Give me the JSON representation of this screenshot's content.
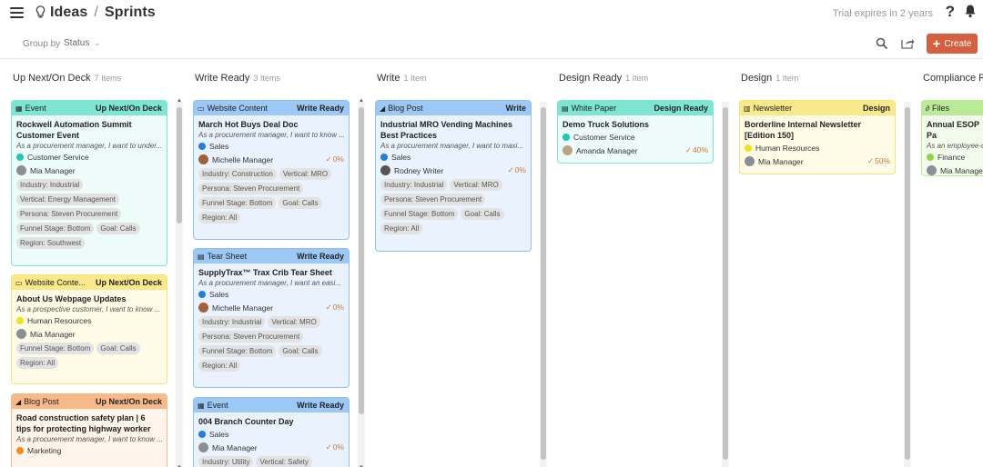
{
  "header": {
    "breadcrumb": [
      "Ideas",
      "Sprints"
    ],
    "trial": "Trial expires in 2 years"
  },
  "toolbar": {
    "group_by_label": "Group by",
    "group_by_value": "Status",
    "create_label": "Create"
  },
  "columns": [
    {
      "title": "Up Next/On Deck",
      "count": "7 Items"
    },
    {
      "title": "Write Ready",
      "count": "3 Items"
    },
    {
      "title": "Write",
      "count": "1 Item"
    },
    {
      "title": "Design Ready",
      "count": "1 Item"
    },
    {
      "title": "Design",
      "count": "1 Item"
    },
    {
      "title": "Compliance Re",
      "count": ""
    }
  ],
  "cards": [
    {
      "type": "Event",
      "status": "Up Next/On Deck",
      "title": "Rockwell Automation Summit Customer Event",
      "desc": "As a procurement manager, I want to under...",
      "dept": "Customer Service",
      "owner": "Mia Manager",
      "pct": "",
      "tags": [
        "Industry: Industrial",
        "Vertical: Energy Management",
        "Persona: Steven Procurement",
        "Funnel Stage: Bottom",
        "Goal: Calls",
        "Region: Southwest"
      ]
    },
    {
      "type": "Website Conte...",
      "status": "Up Next/On Deck",
      "title": "About Us Webpage Updates",
      "desc": "As a prospective customer, I want to know ...",
      "dept": "Human Resources",
      "owner": "Mia Manager",
      "pct": "",
      "tags": [
        "Funnel Stage: Bottom",
        "Goal: Calls",
        "Region: All"
      ]
    },
    {
      "type": "Blog Post",
      "status": "Up Next/On Deck",
      "title": "Road construction safety plan | 6 tips for protecting highway worker",
      "desc": "As a procurement manager, I want to know ...",
      "dept": "Marketing",
      "owner": "",
      "pct": "",
      "tags": []
    },
    {
      "type": "Website Content",
      "status": "Write Ready",
      "title": "March Hot Buys Deal Doc",
      "desc": "As a procurement manager, I want to know ...",
      "dept": "Sales",
      "owner": "Michelle Manager",
      "pct": "0%",
      "tags": [
        "Industry: Construction",
        "Vertical: MRO",
        "Persona: Steven Procurement",
        "Funnel Stage: Bottom",
        "Goal: Calls",
        "Region: All"
      ]
    },
    {
      "type": "Tear Sheet",
      "status": "Write Ready",
      "title": "SupplyTrax™ Trax Crib Tear Sheet",
      "desc": "As a procurement manager, I want an easi...",
      "dept": "Sales",
      "owner": "Michelle Manager",
      "pct": "0%",
      "tags": [
        "Industry: Industrial",
        "Vertical: MRO",
        "Persona: Steven Procurement",
        "Funnel Stage: Bottom",
        "Goal: Calls",
        "Region: All"
      ]
    },
    {
      "type": "Event",
      "status": "Write Ready",
      "title": "004 Branch Counter Day",
      "desc": "",
      "dept": "Sales",
      "owner": "Mia Manager",
      "pct": "0%",
      "tags": [
        "Industry: Utility",
        "Vertical: Safety"
      ]
    },
    {
      "type": "Blog Post",
      "status": "Write",
      "title": "Industrial MRO Vending Machines Best Practices",
      "desc": "As a procurement manager, I want to maxi...",
      "dept": "Sales",
      "owner": "Rodney Writer",
      "pct": "0%",
      "tags": [
        "Industry: Industrial",
        "Vertical: MRO",
        "Persona: Steven Procurement",
        "Funnel Stage: Bottom",
        "Goal: Calls",
        "Region: All"
      ]
    },
    {
      "type": "White Paper",
      "status": "Design Ready",
      "title": "Demo Truck Solutions",
      "desc": "",
      "dept": "Customer Service",
      "owner": "Amanda Manager",
      "pct": "40%",
      "tags": []
    },
    {
      "type": "Newsletter",
      "status": "Design",
      "title": "Borderline Internal Newsletter [Edition 150]",
      "desc": "",
      "dept": "Human Resources",
      "owner": "Mia Manager",
      "pct": "50%",
      "tags": []
    },
    {
      "type": "Files",
      "status": "",
      "title": "Annual ESOP Pa",
      "desc": "As an employee-o",
      "dept": "Finance",
      "owner": "Mia Manage",
      "pct": "",
      "tags": []
    }
  ],
  "colors": {
    "event_head": "#7fe5d3",
    "event_bg": "#eefcf9",
    "website_head": "#f9e98a",
    "website_bg": "#fffbe6",
    "blog_head": "#f8b98a",
    "blog_bg": "#fff4ea",
    "writeready_head": "#9cc8f5",
    "writeready_bg": "#eaf3fd",
    "create_button": "#d4603f"
  }
}
